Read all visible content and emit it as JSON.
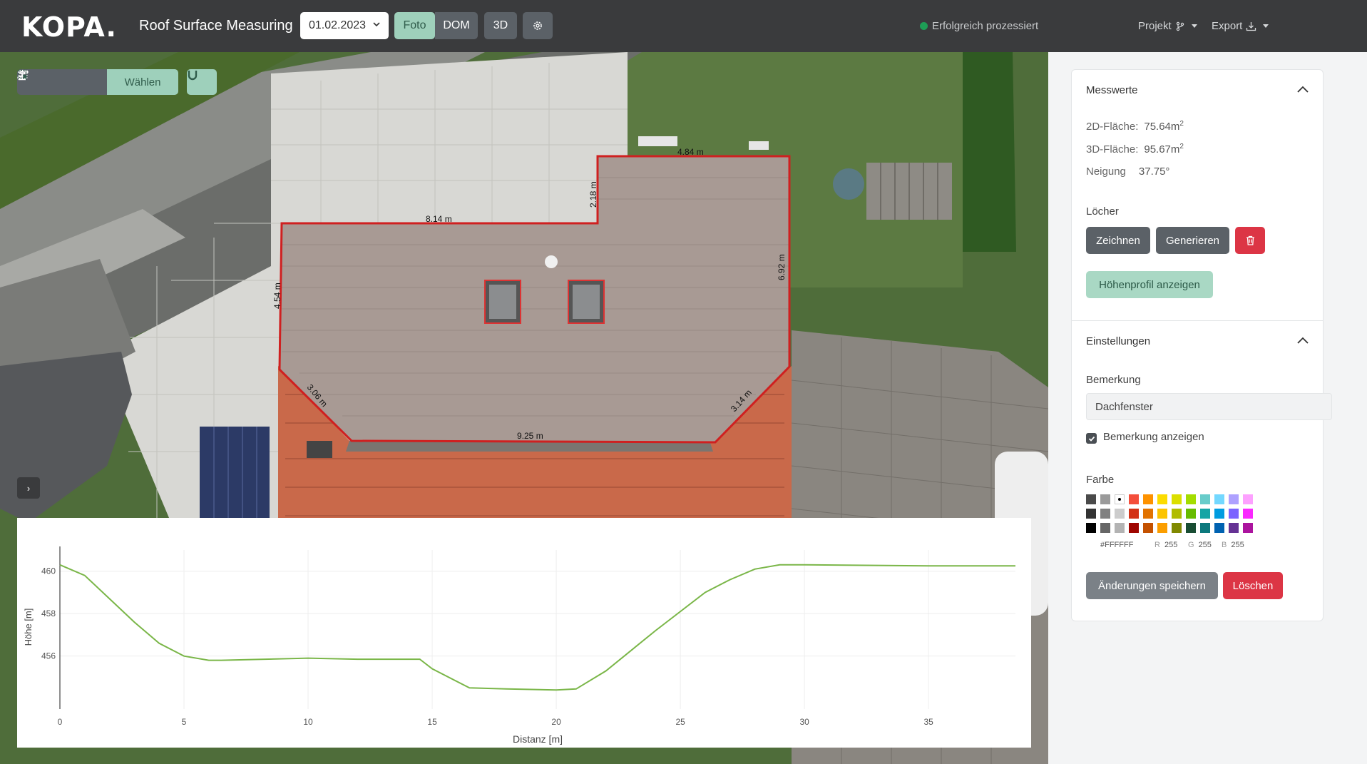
{
  "header": {
    "logo": "KOPA.",
    "app_title": "Roof Surface Measuring",
    "date": "01.02.2023",
    "tabs": [
      {
        "label": "Foto",
        "active": true
      },
      {
        "label": "DOM",
        "active": false
      },
      {
        "label": "3D",
        "active": false
      }
    ],
    "status_text": "Erfolgreich prozessiert",
    "status_color": "#1e9e56",
    "menu_project": "Projekt",
    "menu_export": "Export"
  },
  "map": {
    "toolbar_select_label": "Wählen",
    "measurements": {
      "top_right": "4.84 m",
      "step_vertical": "2.18 m",
      "top_left": "8.14 m",
      "left_side": "4.54 m",
      "right_side": "6.92 m",
      "bottom_left_diag": "3.06 m",
      "bottom": "9.25 m",
      "bottom_right_diag": "3.14 m"
    }
  },
  "chart_data": {
    "type": "line",
    "xlabel": "Distanz [m]",
    "ylabel": "Höhe [m]",
    "xlim": [
      0,
      38.5
    ],
    "ylim": [
      453.5,
      461
    ],
    "xticks": [
      0,
      5,
      10,
      15,
      20,
      25,
      30,
      35
    ],
    "yticks": [
      456,
      458,
      460
    ],
    "color": "#7ab648",
    "series": [
      {
        "x": [
          0,
          1,
          2,
          3,
          4,
          5,
          6,
          6.5,
          10,
          12,
          14.5,
          15,
          16.5,
          18,
          20,
          20.8,
          22,
          24,
          26,
          27,
          28,
          29,
          30,
          35,
          38.5
        ],
        "y": [
          460.3,
          459.8,
          458.7,
          457.6,
          456.6,
          456.0,
          455.8,
          455.8,
          455.9,
          455.85,
          455.85,
          455.4,
          454.5,
          454.45,
          454.4,
          454.45,
          455.3,
          457.2,
          459.0,
          459.6,
          460.1,
          460.3,
          460.3,
          460.25,
          460.25
        ]
      }
    ]
  },
  "panel": {
    "measures_title": "Messwerte",
    "area2d_label": "2D-Fläche:",
    "area2d_value": "75.64m",
    "area3d_label": "3D-Fläche:",
    "area3d_value": "95.67m",
    "area_exp": "2",
    "slope_label": "Neigung",
    "slope_value": "37.75°",
    "holes_label": "Löcher",
    "btn_draw": "Zeichnen",
    "btn_generate": "Generieren",
    "btn_profile": "Höhenprofil anzeigen",
    "settings_title": "Einstellungen",
    "remark_label": "Bemerkung",
    "remark_value": "Dachfenster",
    "show_remark_label": "Bemerkung anzeigen",
    "color_label": "Farbe",
    "hex": "#FFFFFF",
    "r_label": "R",
    "r_value": "255",
    "g_label": "G",
    "g_value": "255",
    "b_label": "B",
    "b_value": "255",
    "btn_save": "Änderungen speichern",
    "btn_delete": "Löschen",
    "swatches": [
      "#4a4a4a",
      "#9a9a9a",
      "#ffffff",
      "#f44e3b",
      "#fe9200",
      "#fcdc00",
      "#dbdf00",
      "#a4dd00",
      "#68ccca",
      "#73d8ff",
      "#aea1ff",
      "#fda1ff",
      "#333333",
      "#808080",
      "#cccccc",
      "#d33115",
      "#e27300",
      "#fcc400",
      "#b0bc00",
      "#68bc00",
      "#16a5a5",
      "#009ce0",
      "#7b64ff",
      "#fa28ff",
      "#000000",
      "#666666",
      "#b3b3b3",
      "#9f0500",
      "#c45100",
      "#fb9e00",
      "#808900",
      "#194d33",
      "#0c797d",
      "#0062b1",
      "#653294",
      "#ab149e"
    ]
  }
}
